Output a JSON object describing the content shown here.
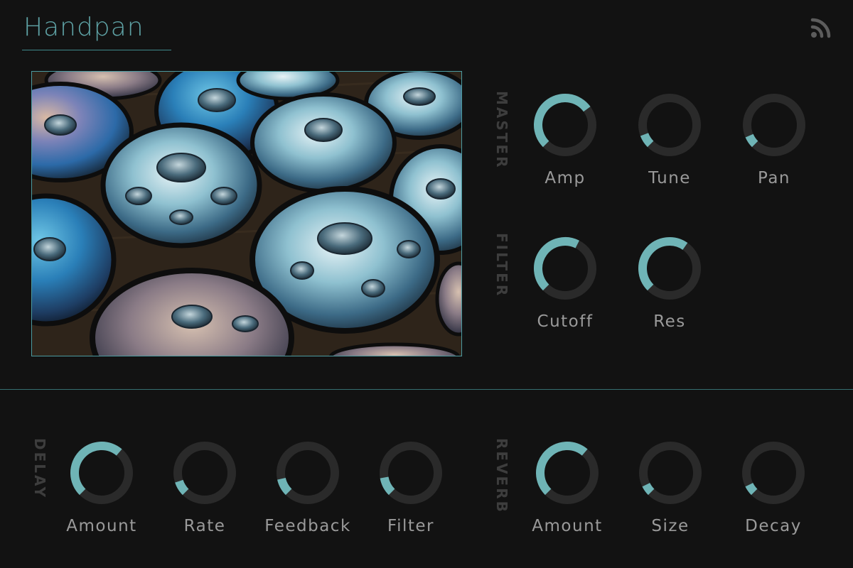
{
  "header": {
    "title": "Handpan",
    "feed_icon": "rss-icon"
  },
  "sections": {
    "master": "MASTER",
    "filter": "FILTER",
    "delay": "DELAY",
    "reverb": "REVERB"
  },
  "colors": {
    "accent": "#6fb4b6",
    "track": "#2a2a2a",
    "label": "#9a9a9a",
    "section": "#3d3d3d",
    "background": "#121212"
  },
  "knobs": {
    "master_amp": {
      "label": "Amp",
      "value": 0.7
    },
    "master_tune": {
      "label": "Tune",
      "value": 0.09
    },
    "master_pan": {
      "label": "Pan",
      "value": 0.08
    },
    "filter_cutoff": {
      "label": "Cutoff",
      "value": 0.6
    },
    "filter_res": {
      "label": "Res",
      "value": 0.63
    },
    "delay_amount": {
      "label": "Amount",
      "value": 0.65
    },
    "delay_rate": {
      "label": "Rate",
      "value": 0.1
    },
    "delay_feedback": {
      "label": "Feedback",
      "value": 0.12
    },
    "delay_filter": {
      "label": "Filter",
      "value": 0.13
    },
    "reverb_amount": {
      "label": "Amount",
      "value": 0.65
    },
    "reverb_size": {
      "label": "Size",
      "value": 0.07
    },
    "reverb_decay": {
      "label": "Decay",
      "value": 0.07
    }
  }
}
